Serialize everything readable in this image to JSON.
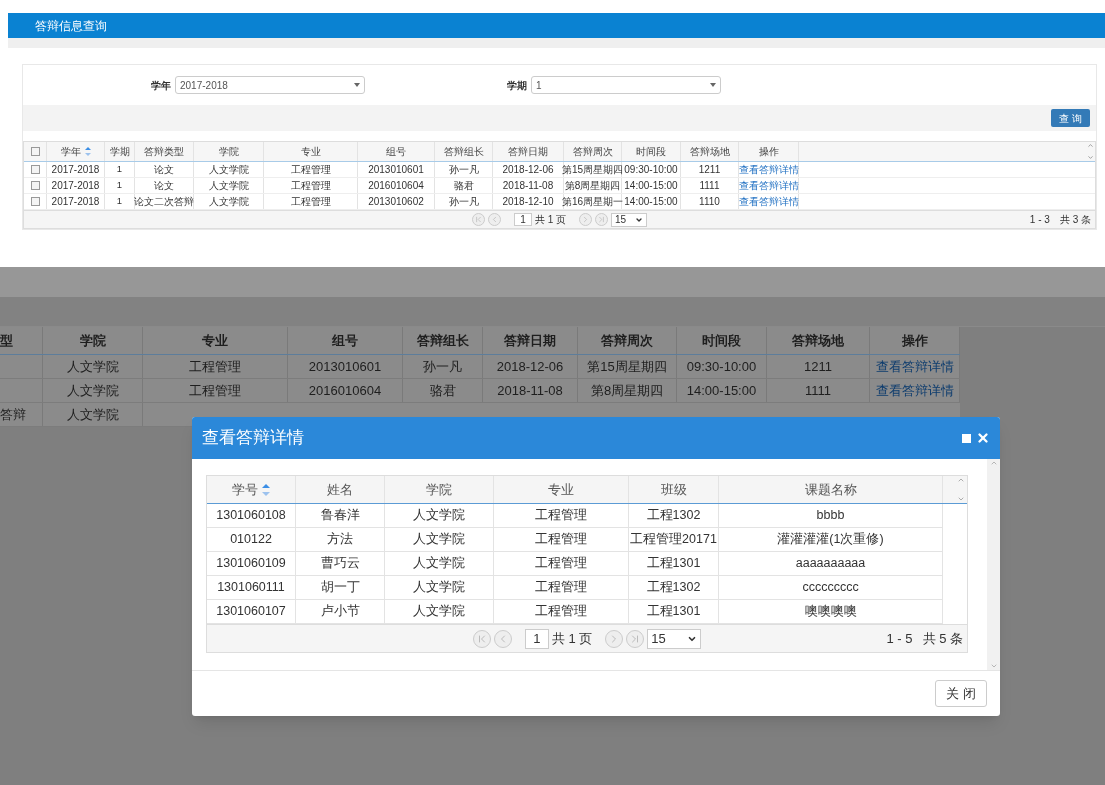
{
  "page": {
    "title": "答辩信息查询"
  },
  "filters": [
    {
      "label": "学年",
      "value": "2017-2018"
    },
    {
      "label": "学期",
      "value": "1"
    }
  ],
  "query_button": "查 询",
  "table": {
    "header_checked": false,
    "columns": [
      {
        "label": "学年",
        "sortable": true
      },
      {
        "label": "学期",
        "sortable": false
      },
      {
        "label": "答辩类型",
        "sortable": false
      },
      {
        "label": "学院",
        "sortable": false
      },
      {
        "label": "专业",
        "sortable": false
      },
      {
        "label": "组号",
        "sortable": false
      },
      {
        "label": "答辩组长",
        "sortable": false
      },
      {
        "label": "答辩日期",
        "sortable": false
      },
      {
        "label": "答辩周次",
        "sortable": false
      },
      {
        "label": "时间段",
        "sortable": false
      },
      {
        "label": "答辩场地",
        "sortable": false
      },
      {
        "label": "操作",
        "sortable": false
      }
    ],
    "rows": [
      {
        "checked": false,
        "cells": [
          "2017-2018",
          "1",
          "论文",
          "人文学院",
          "工程管理",
          "2013010601",
          "孙一凡",
          "2018-12-06",
          "第15周星期四",
          "09:30-10:00",
          "1211"
        ],
        "action": "查看答辩详情"
      },
      {
        "checked": false,
        "cells": [
          "2017-2018",
          "1",
          "论文",
          "人文学院",
          "工程管理",
          "2016010604",
          "骆君",
          "2018-11-08",
          "第8周星期四",
          "14:00-15:00",
          "1111"
        ],
        "action": "查看答辩详情"
      },
      {
        "checked": false,
        "cells": [
          "2017-2018",
          "1",
          "论文二次答辩",
          "人文学院",
          "工程管理",
          "2013010602",
          "孙一凡",
          "2018-12-10",
          "第16周星期一",
          "14:00-15:00",
          "1110"
        ],
        "action": "查看答辩详情"
      }
    ],
    "pager": {
      "page": "1",
      "total_pages": "共 1 页",
      "page_size": "15",
      "range": "1 - 3",
      "total": "共 3 条"
    }
  },
  "zoomed_view": {
    "columns": [
      "型",
      "学院",
      "专业",
      "组号",
      "答辩组长",
      "答辩日期",
      "答辩周次",
      "时间段",
      "答辩场地",
      "操作"
    ],
    "rows": [
      {
        "cells": [
          "",
          "人文学院",
          "工程管理",
          "2013010601",
          "孙一凡",
          "2018-12-06",
          "第15周星期四",
          "09:30-10:00",
          "1211"
        ],
        "action": "查看答辩详情"
      },
      {
        "cells": [
          "",
          "人文学院",
          "工程管理",
          "2016010604",
          "骆君",
          "2018-11-08",
          "第8周星期四",
          "14:00-15:00",
          "1111"
        ],
        "action": "查看答辩详情"
      },
      {
        "cells": [
          "答辩",
          "人文学院"
        ]
      }
    ]
  },
  "modal": {
    "title": "查看答辩详情",
    "columns": [
      {
        "label": "学号",
        "sortable": true
      },
      {
        "label": "姓名",
        "sortable": false
      },
      {
        "label": "学院",
        "sortable": false
      },
      {
        "label": "专业",
        "sortable": false
      },
      {
        "label": "班级",
        "sortable": false
      },
      {
        "label": "课题名称",
        "sortable": false
      }
    ],
    "rows": [
      [
        "1301060108",
        "鲁春洋",
        "人文学院",
        "工程管理",
        "工程1302",
        "bbbb"
      ],
      [
        "010122",
        "方法",
        "人文学院",
        "工程管理",
        "工程管理20171",
        "灌灌灌灌(1次重修)"
      ],
      [
        "1301060109",
        "曹巧云",
        "人文学院",
        "工程管理",
        "工程1301",
        "aaaaaaaaaa"
      ],
      [
        "1301060111",
        "胡一丁",
        "人文学院",
        "工程管理",
        "工程1302",
        "ccccccccc"
      ],
      [
        "1301060107",
        "卢小节",
        "人文学院",
        "工程管理",
        "工程1301",
        "噢噢噢噢"
      ]
    ],
    "pager": {
      "page": "1",
      "total_pages": "共 1 页",
      "page_size": "15",
      "range": "1 - 5",
      "total": "共 5 条"
    },
    "close_button": "关 闭"
  }
}
